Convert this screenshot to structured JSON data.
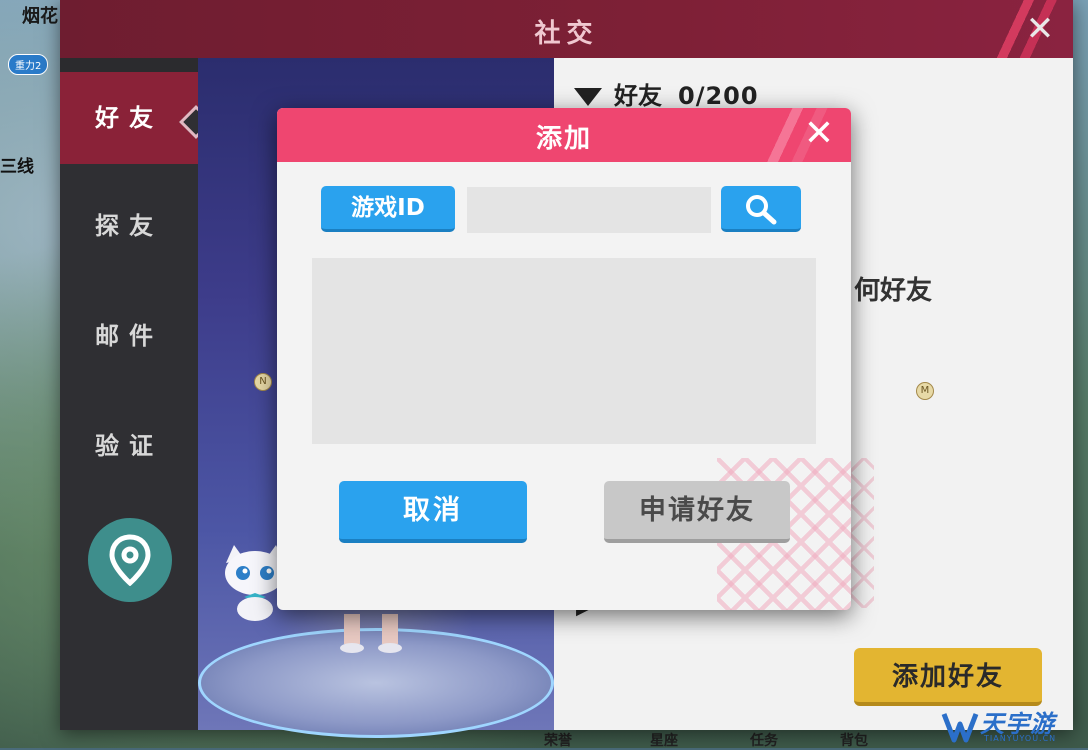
{
  "background": {
    "top_left_text": "烟花",
    "badge": "重力2",
    "line_text": "三线",
    "bottom_labels": [
      "荣誉",
      "星座",
      "任务",
      "背包"
    ]
  },
  "social": {
    "title": "社交",
    "close_icon": "close-icon",
    "nav": [
      {
        "label": "好友",
        "active": true
      },
      {
        "label": "探友",
        "active": false
      },
      {
        "label": "邮件",
        "active": false
      },
      {
        "label": "验证",
        "active": false
      }
    ],
    "location_icon": "location-pin-icon",
    "friends": {
      "section_label": "好友",
      "count": "0/200",
      "empty_note": "何好友",
      "add_button": "添加好友"
    },
    "markers": [
      "N",
      "M"
    ]
  },
  "dialog": {
    "title": "添加",
    "close_icon": "close-icon",
    "id_label": "游戏ID",
    "id_input_value": "",
    "search_icon": "search-icon",
    "cancel_label": "取消",
    "apply_label": "申请好友"
  },
  "watermark": {
    "text": "天宇游",
    "sub": "TIANYUYOU.CN"
  },
  "colors": {
    "dialog_header": "#ef4670",
    "primary_button": "#2aa2ee",
    "disabled_button": "#c8c8c8",
    "social_header": "#7e2036",
    "nav_active": "#8a2238",
    "gold_button": "#e3b531"
  }
}
